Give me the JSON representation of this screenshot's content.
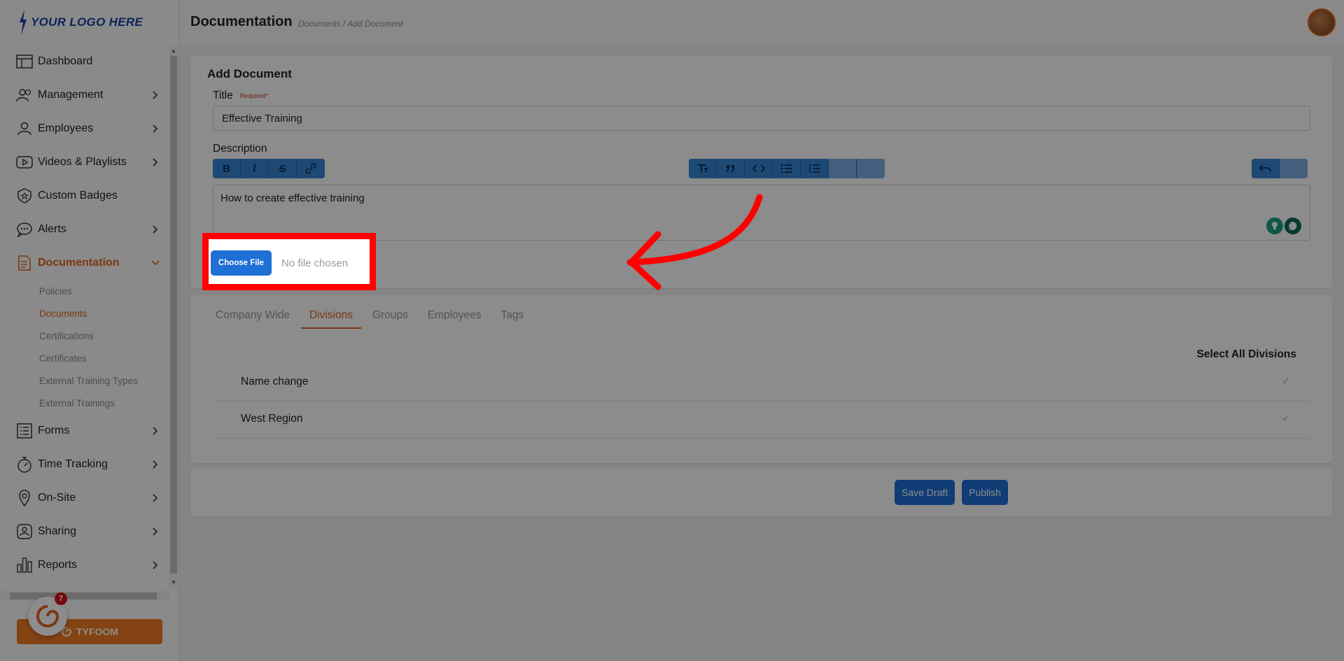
{
  "logo": {
    "text": "YOUR LOGO HERE"
  },
  "header": {
    "title": "Documentation",
    "breadcrumb": "Documents / Add Document"
  },
  "sidebar": {
    "items": [
      {
        "label": "Dashboard",
        "icon": "dashboard-icon"
      },
      {
        "label": "Management",
        "icon": "people-icon"
      },
      {
        "label": "Employees",
        "icon": "person-icon"
      },
      {
        "label": "Videos & Playlists",
        "icon": "play-icon"
      },
      {
        "label": "Custom Badges",
        "icon": "badge-icon"
      },
      {
        "label": "Alerts",
        "icon": "chat-icon"
      },
      {
        "label": "Documentation",
        "icon": "document-icon"
      },
      {
        "label": "Forms",
        "icon": "list-icon"
      },
      {
        "label": "Time Tracking",
        "icon": "stopwatch-icon"
      },
      {
        "label": "On-Site",
        "icon": "location-icon"
      },
      {
        "label": "Sharing",
        "icon": "share-icon"
      },
      {
        "label": "Reports",
        "icon": "bar-chart-icon"
      }
    ],
    "sub_items": [
      "Policies",
      "Documents",
      "Certifications",
      "Certificates",
      "External Training Types",
      "External Trainings"
    ],
    "tyfoom_label": "TYFOOM",
    "notification_count": "7"
  },
  "form": {
    "card_title": "Add Document",
    "title_label": "Title",
    "required_label": "Required*",
    "title_value": "Effective Training",
    "description_label": "Description",
    "description_value": "How to create effective training",
    "choose_file_label": "Choose File",
    "no_file_label": "No file chosen"
  },
  "tabs": [
    "Company Wide",
    "Divisions",
    "Groups",
    "Employees",
    "Tags"
  ],
  "divisions": {
    "select_all_label": "Select All Divisions",
    "rows": [
      "Name change",
      "West Region"
    ]
  },
  "actions": {
    "save_draft": "Save Draft",
    "publish": "Publish"
  },
  "colors": {
    "accent": "#e0661e",
    "primary": "#1e6fd6",
    "highlight": "#ff0000"
  }
}
